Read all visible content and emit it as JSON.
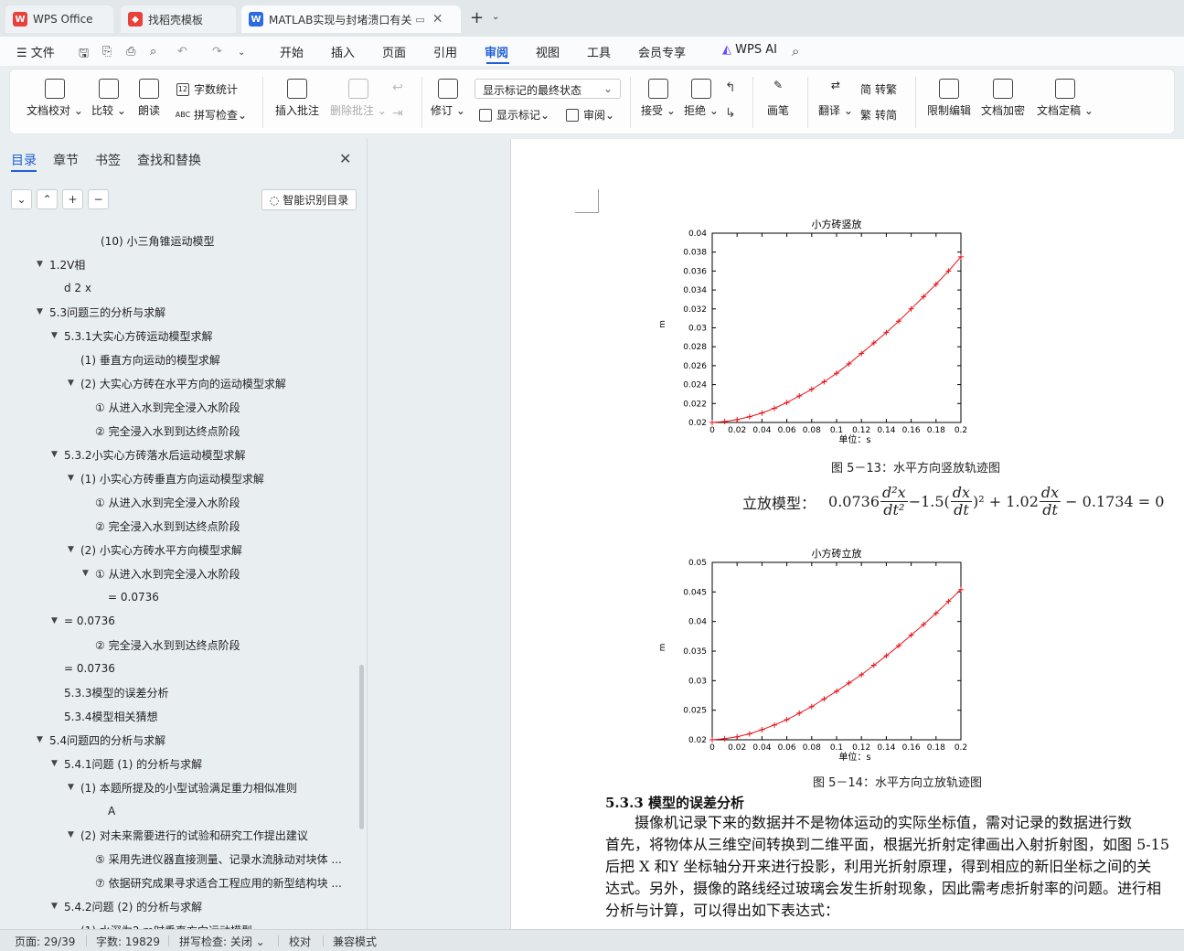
{
  "tabs": [
    {
      "label": "WPS Office",
      "icon": "wps-logo-icon",
      "color": "#e8413c"
    },
    {
      "label": "找稻壳模板",
      "icon": "docer-icon",
      "color": "#e8413c"
    },
    {
      "label": "MATLAB实现与封堵溃口有关",
      "icon": "word-doc-icon",
      "color": "#2b6ae0"
    }
  ],
  "menu": {
    "file": "文件",
    "items": [
      "开始",
      "插入",
      "页面",
      "引用",
      "审阅",
      "视图",
      "工具",
      "会员专享"
    ],
    "active": "审阅",
    "ai": "WPS AI"
  },
  "ribbon": {
    "doc_proof": "文档校对",
    "compare": "比较",
    "read_aloud": "朗读",
    "word_count": "字数统计",
    "spell_check": "拼写检查",
    "insert_comment": "插入批注",
    "delete_comment": "删除批注",
    "track_changes": "修订",
    "markup_select": "显示标记的最终状态",
    "show_markup": "显示标记",
    "review": "审阅",
    "accept": "接受",
    "reject": "拒绝",
    "draw": "画笔",
    "translate": "翻译",
    "to_traditional": "转繁",
    "to_simplified": "转简",
    "restrict_edit": "限制编辑",
    "encrypt": "文档加密",
    "finalize": "文档定稿"
  },
  "sidebar": {
    "tabs": [
      "目录",
      "章节",
      "书签",
      "查找和替换"
    ],
    "smart_toc": "智能识别目录",
    "toc": [
      {
        "label": "(10) 小三角锥运动模型",
        "level": 4,
        "arrow": false
      },
      {
        "label": "1.2V相",
        "level": 1,
        "arrow": true
      },
      {
        "label": "d 2 x",
        "level": 2,
        "arrow": false
      },
      {
        "label": "5.3问题三的分析与求解",
        "level": 1,
        "arrow": true
      },
      {
        "label": "5.3.1大实心方砖运动模型求解",
        "level": 2,
        "arrow": true
      },
      {
        "label": "(1) 垂直方向运动的模型求解",
        "level": 3,
        "arrow": false
      },
      {
        "label": "(2) 大实心方砖在水平方向的运动模型求解",
        "level": 3,
        "arrow": true
      },
      {
        "label": "① 从进入水到完全浸入水阶段",
        "level": 4,
        "arrow": false
      },
      {
        "label": "② 完全浸入水到到达终点阶段",
        "level": 4,
        "arrow": false
      },
      {
        "label": "5.3.2小实心方砖落水后运动模型求解",
        "level": 2,
        "arrow": true
      },
      {
        "label": "(1) 小实心方砖垂直方向运动模型求解",
        "level": 3,
        "arrow": true
      },
      {
        "label": "① 从进入水到完全浸入水阶段",
        "level": 4,
        "arrow": false
      },
      {
        "label": "② 完全浸入水到到达终点阶段",
        "level": 4,
        "arrow": false
      },
      {
        "label": "(2) 小实心方砖水平方向模型求解",
        "level": 3,
        "arrow": true
      },
      {
        "label": "① 从进入水到完全浸入水阶段",
        "level": 4,
        "arrow": true
      },
      {
        "label": "= 0.0736",
        "level": 5,
        "arrow": false
      },
      {
        "label": "= 0.0736",
        "level": 2,
        "arrow": true
      },
      {
        "label": "② 完全浸入水到到达终点阶段",
        "level": 4,
        "arrow": false
      },
      {
        "label": "= 0.0736",
        "level": 2,
        "arrow": false
      },
      {
        "label": "5.3.3模型的误差分析",
        "level": 2,
        "arrow": false
      },
      {
        "label": "5.3.4模型相关猜想",
        "level": 2,
        "arrow": false
      },
      {
        "label": "5.4问题四的分析与求解",
        "level": 1,
        "arrow": true
      },
      {
        "label": "5.4.1问题 (1) 的分析与求解",
        "level": 2,
        "arrow": true
      },
      {
        "label": "(1) 本题所提及的小型试验满足重力相似准则",
        "level": 3,
        "arrow": true
      },
      {
        "label": "A",
        "level": 3.5,
        "arrow": false
      },
      {
        "label": "(2) 对未来需要进行的试验和研究工作提出建议",
        "level": 3,
        "arrow": true
      },
      {
        "label": "⑤ 采用先进仪器直接测量、记录水流脉动对块体 ...",
        "level": 4,
        "arrow": false
      },
      {
        "label": "⑦ 依据研究成果寻求适合工程应用的新型结构块 ...",
        "level": 4,
        "arrow": false
      },
      {
        "label": "5.4.2问题 (2) 的分析与求解",
        "level": 2,
        "arrow": true
      },
      {
        "label": "(1) 水深为2 m时垂直方向运动模型",
        "level": 3,
        "arrow": false
      }
    ]
  },
  "chart_data": [
    {
      "type": "line",
      "title": "小方砖竖放",
      "xlabel": "单位：s",
      "ylabel": "m",
      "xlim": [
        0,
        0.2
      ],
      "ylim": [
        0.02,
        0.04
      ],
      "xticks": [
        "0",
        "0.02",
        "0.04",
        "0.06",
        "0.08",
        "0.1",
        "0.12",
        "0.14",
        "0.16",
        "0.18",
        "0.2"
      ],
      "yticks": [
        "0.02",
        "0.022",
        "0.024",
        "0.026",
        "0.028",
        "0.03",
        "0.032",
        "0.034",
        "0.036",
        "0.038",
        "0.04"
      ],
      "x": [
        0,
        0.01,
        0.02,
        0.03,
        0.04,
        0.05,
        0.06,
        0.07,
        0.08,
        0.09,
        0.1,
        0.11,
        0.12,
        0.13,
        0.14,
        0.15,
        0.16,
        0.17,
        0.18,
        0.19,
        0.2
      ],
      "y": [
        0.02,
        0.0201,
        0.0203,
        0.0206,
        0.021,
        0.0215,
        0.0221,
        0.0228,
        0.0235,
        0.0243,
        0.0252,
        0.0262,
        0.0273,
        0.0284,
        0.0295,
        0.0307,
        0.032,
        0.0333,
        0.0346,
        0.036,
        0.0375
      ],
      "color": "#e8141b"
    },
    {
      "type": "line",
      "title": "小方砖立放",
      "xlabel": "单位：s",
      "ylabel": "m",
      "xlim": [
        0,
        0.2
      ],
      "ylim": [
        0.02,
        0.05
      ],
      "xticks": [
        "0",
        "0.02",
        "0.04",
        "0.06",
        "0.08",
        "0.1",
        "0.12",
        "0.14",
        "0.16",
        "0.18",
        "0.2"
      ],
      "yticks": [
        "0.02",
        "0.025",
        "0.03",
        "0.035",
        "0.04",
        "0.045",
        "0.05"
      ],
      "x": [
        0,
        0.01,
        0.02,
        0.03,
        0.04,
        0.05,
        0.06,
        0.07,
        0.08,
        0.09,
        0.1,
        0.11,
        0.12,
        0.13,
        0.14,
        0.15,
        0.16,
        0.17,
        0.18,
        0.19,
        0.2
      ],
      "y": [
        0.02,
        0.0202,
        0.0205,
        0.021,
        0.0217,
        0.0225,
        0.0234,
        0.0245,
        0.0256,
        0.0269,
        0.0282,
        0.0296,
        0.031,
        0.0326,
        0.0342,
        0.0359,
        0.0377,
        0.0395,
        0.0414,
        0.0434,
        0.0454
      ],
      "color": "#e8141b"
    }
  ],
  "document": {
    "caption1": "图 5－13：水平方向竖放轨迹图",
    "formula_label": "立放模型：",
    "formula_coef1": "0.0736",
    "formula_mid": "−1.5(",
    "formula_mid2": ")² + 1.02",
    "formula_end": "− 0.1734 = 0",
    "caption2": "图 5－14：水平方向立放轨迹图",
    "heading": "5.3.3 模型的误差分析",
    "paragraph_lines": [
      "　　摄像机记录下来的数据并不是物体运动的实际坐标值，需对记录的数据进行数",
      "首先，将物体从三维空间转换到二维平面，根据光折射定律画出入射折射图，如图 5-15",
      "后把 X 和Y 坐标轴分开来进行投影，利用光折射原理，得到相应的新旧坐标之间的关",
      "达式。另外，摄像的路线经过玻璃会发生折射现象，因此需考虑折射率的问题。进行相",
      "分析与计算，可以得出如下表达式："
    ]
  },
  "status": {
    "page": "页面: 29/39",
    "words": "字数: 19829",
    "spell": "拼写检查: 关闭",
    "proof": "校对",
    "compat": "兼容模式"
  }
}
